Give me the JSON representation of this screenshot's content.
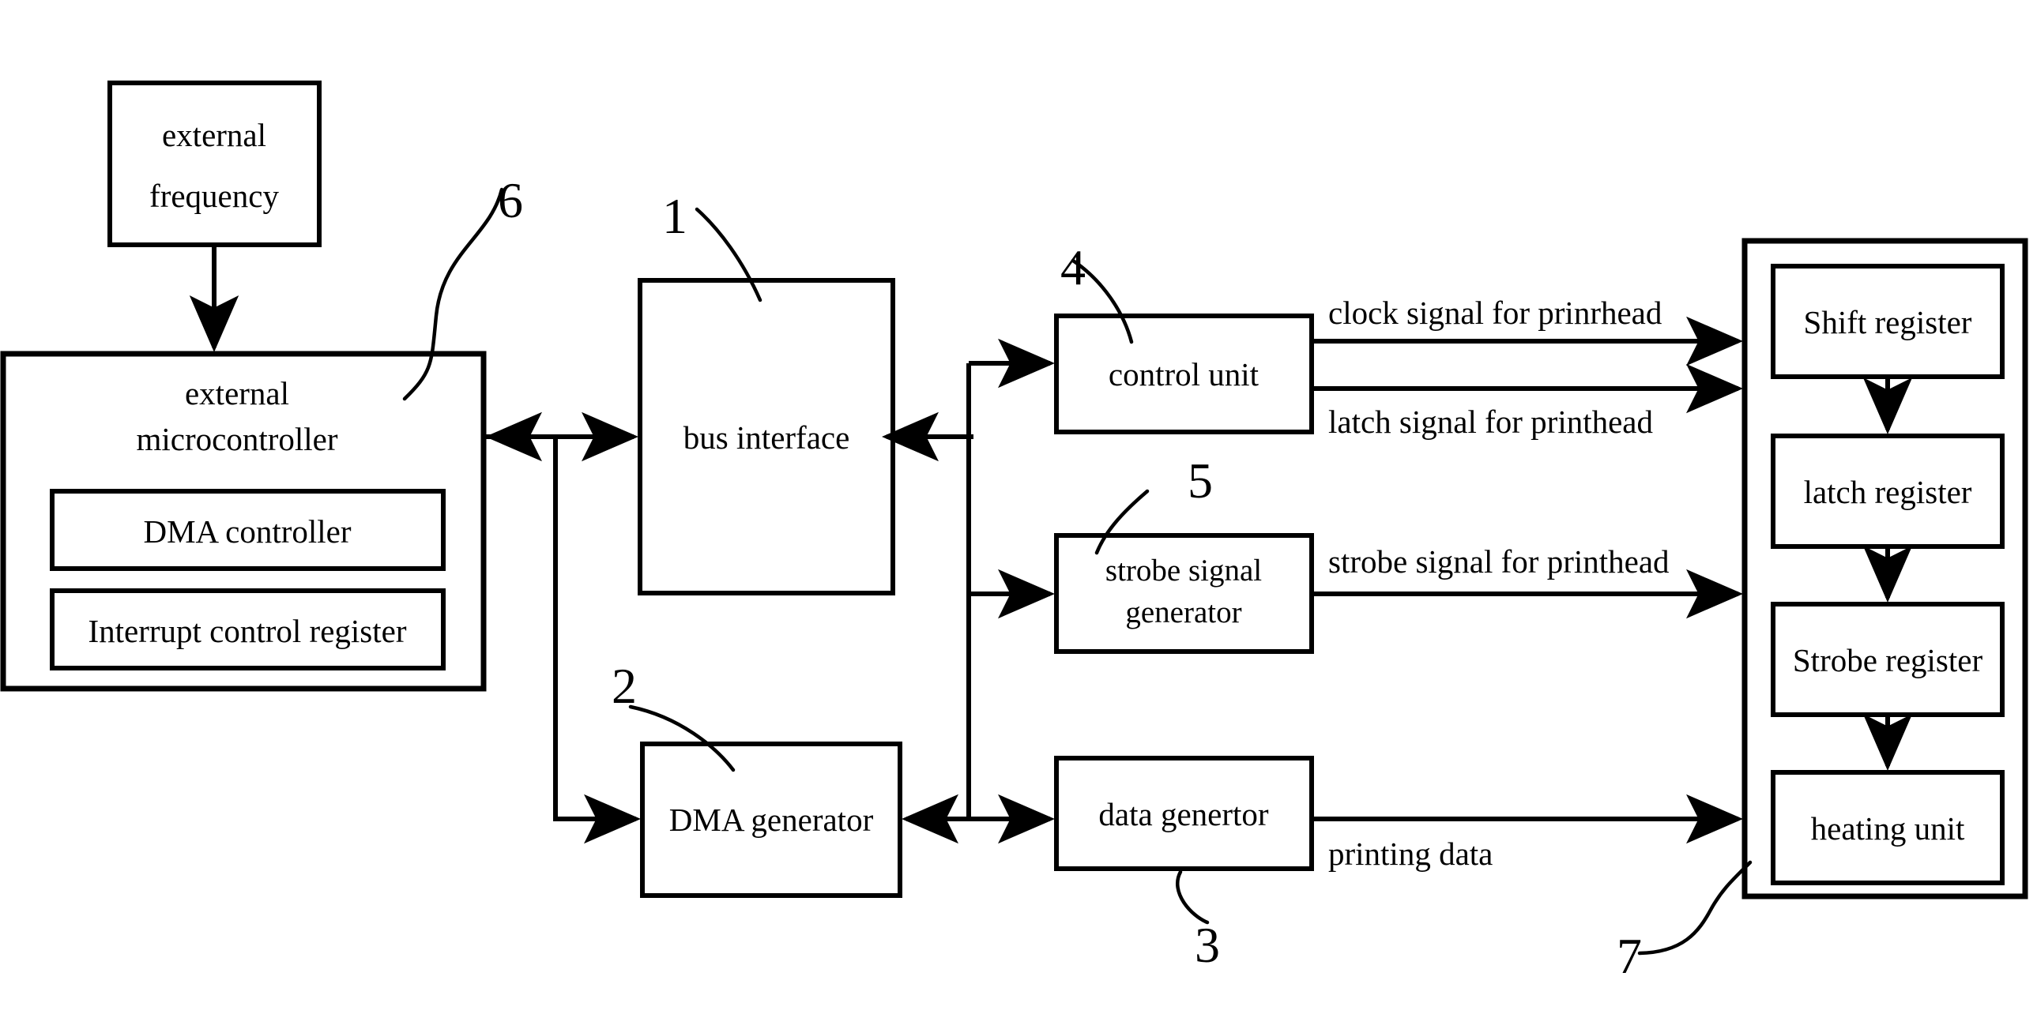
{
  "diagram": {
    "blocks": {
      "external_frequency": "external\nfrequency",
      "external_frequency_l1": "external",
      "external_frequency_l2": "frequency",
      "external_microcontroller_l1": "external",
      "external_microcontroller_l2": "microcontroller",
      "dma_controller": "DMA  controller",
      "interrupt_control_register": "Interrupt control register",
      "bus_interface": "bus interface",
      "dma_generator": "DMA generator",
      "control_unit": "control unit",
      "strobe_signal_generator_l1": "strobe signal",
      "strobe_signal_generator_l2": "generator",
      "data_generator": "data genertor",
      "shift_register": "Shift register",
      "latch_register": "latch register",
      "strobe_register": "Strobe register",
      "heating_unit": "heating unit"
    },
    "signals": {
      "clock": "clock signal for prinrhead",
      "latch": "latch signal for printhead",
      "strobe": "strobe signal for printhead",
      "printing_data": "printing data"
    },
    "reference_numerals": {
      "n1": "1",
      "n2": "2",
      "n3": "3",
      "n4": "4",
      "n5": "5",
      "n6": "6",
      "n7": "7"
    },
    "colors": {
      "stroke": "#000000",
      "background": "#ffffff"
    }
  }
}
